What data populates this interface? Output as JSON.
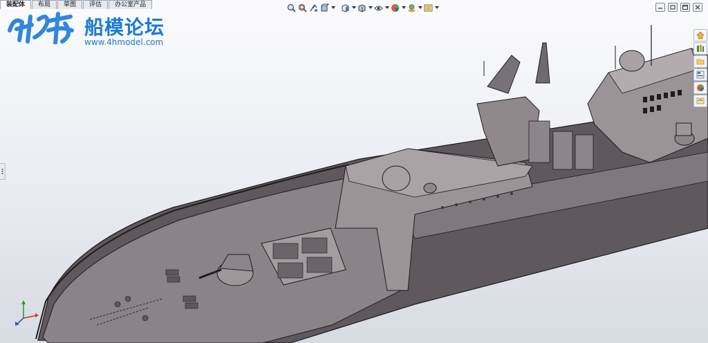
{
  "tabs": [
    {
      "label": "装配体",
      "active": true
    },
    {
      "label": "布局",
      "active": false
    },
    {
      "label": "草图",
      "active": false
    },
    {
      "label": "评估",
      "active": false
    },
    {
      "label": "办公室产品",
      "active": false
    }
  ],
  "watermark": {
    "title": "船模论坛",
    "url": "www.4hmodel.com",
    "color": "#1b7ad6"
  },
  "heads_up_toolbar": [
    "zoom-to-fit-icon",
    "zoom-area-icon",
    "previous-view-icon",
    "section-view-icon",
    "view-orientation-icon",
    "display-style-icon",
    "hide-show-items-icon",
    "edit-appearance-icon",
    "apply-scene-icon",
    "view-settings-icon"
  ],
  "task_pane": [
    "solidworks-resources-icon",
    "design-library-icon",
    "file-explorer-icon",
    "view-palette-icon",
    "appearances-icon",
    "custom-properties-icon"
  ],
  "colors": {
    "hull": "#6b6469",
    "deck": "#8a8387",
    "superstructure": "#9a9497",
    "outline": "#1e1b1d",
    "background_top": "#fbfbfd",
    "background_bottom": "#d7dbe2"
  }
}
